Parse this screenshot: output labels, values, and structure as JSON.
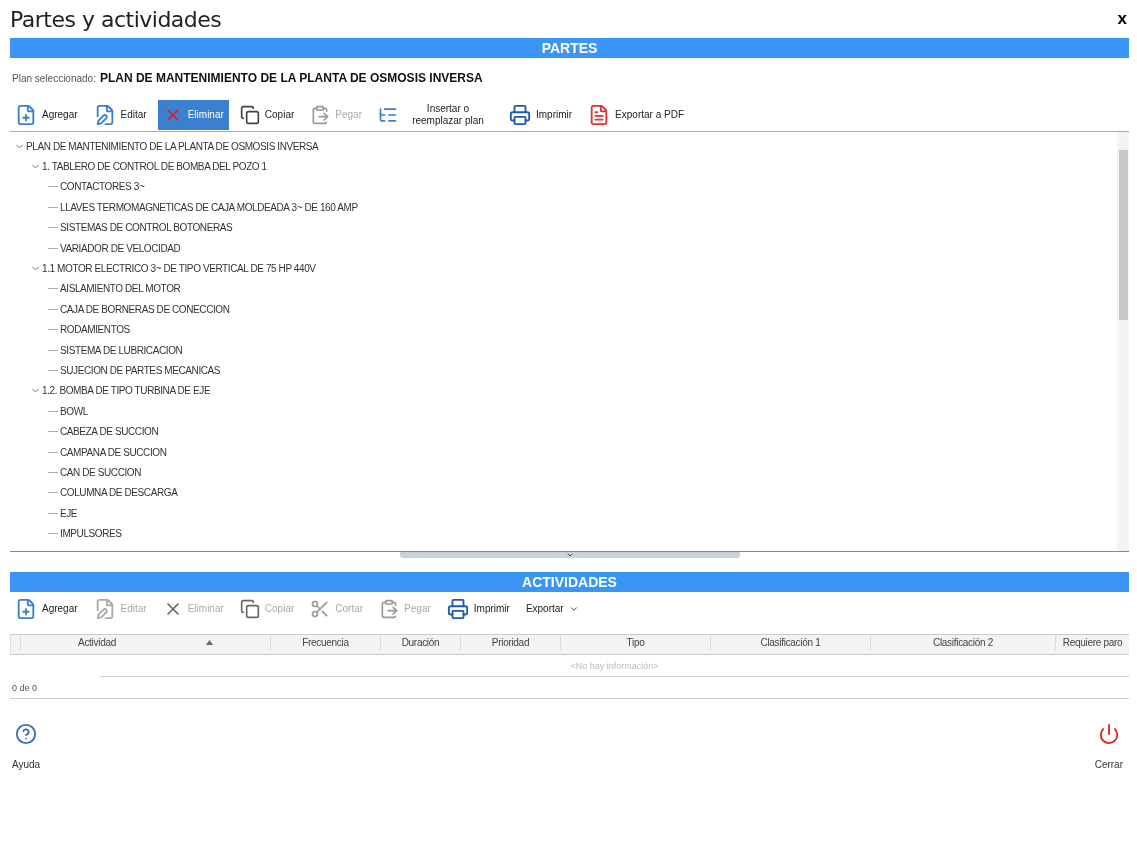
{
  "window": {
    "title": "Partes y actividades",
    "close": "x"
  },
  "parts": {
    "header": "PARTES",
    "plan_label": "Plan seleccionado:",
    "plan_name": "PLAN DE MANTENIMIENTO DE LA PLANTA DE OSMOSIS INVERSA",
    "toolbar": [
      {
        "kind": "button",
        "label": "Agregar",
        "disabled": false,
        "selected": false
      },
      {
        "kind": "button",
        "label": "Editar",
        "disabled": false,
        "selected": false
      },
      {
        "kind": "button",
        "label": "Eliminar",
        "disabled": false,
        "selected": true
      },
      {
        "kind": "button",
        "label": "Copiar",
        "disabled": false,
        "selected": false
      },
      {
        "kind": "button",
        "label": "Pegar",
        "disabled": true,
        "selected": false
      },
      {
        "kind": "button",
        "label": "Insertar o reemplazar plan",
        "disabled": false,
        "selected": false
      },
      {
        "kind": "button",
        "label": "Imprimir",
        "disabled": false,
        "selected": false
      },
      {
        "kind": "button",
        "label": "Exportar a PDF",
        "disabled": false,
        "selected": false
      }
    ],
    "tree": [
      {
        "label": "PLAN DE MANTENIMIENTO DE LA PLANTA DE OSMOSIS INVERSA",
        "expanded": true,
        "children": [
          {
            "label": "1. TABLERO DE CONTROL DE BOMBA DEL POZO 1",
            "expanded": true,
            "children": [
              {
                "label": "CONTACTORES 3~"
              },
              {
                "label": "LLAVES TERMOMAGNETICAS DE CAJA MOLDEADA 3~ DE 160 AMP"
              },
              {
                "label": "SISTEMAS DE CONTROL BOTONERAS"
              },
              {
                "label": "VARIADOR DE VELOCIDAD"
              }
            ]
          },
          {
            "label": "1.1 MOTOR ELECTRICO 3~ DE TIPO VERTICAL DE 75 HP 440V",
            "expanded": true,
            "children": [
              {
                "label": "AISLAMIENTO DEL MOTOR"
              },
              {
                "label": "CAJA DE BORNERAS DE CONECCION"
              },
              {
                "label": "RODAMIENTOS"
              },
              {
                "label": "SISTEMA DE LUBRICACION"
              },
              {
                "label": "SUJECION DE PARTES MECANICAS"
              }
            ]
          },
          {
            "label": "1.2. BOMBA DE TIPO TURBINA DE EJE",
            "expanded": true,
            "children": [
              {
                "label": "BOWL"
              },
              {
                "label": "CABEZA DE SUCCION"
              },
              {
                "label": "CAMPANA DE SUCCION"
              },
              {
                "label": "CAN DE SUCCION"
              },
              {
                "label": "COLUMNA DE DESCARGA"
              },
              {
                "label": "EJE"
              },
              {
                "label": "IMPULSORES"
              }
            ]
          }
        ]
      }
    ]
  },
  "activities": {
    "header": "ACTIVIDADES",
    "toolbar": [
      {
        "kind": "button",
        "label": "Agregar",
        "disabled": false,
        "selected": false
      },
      {
        "kind": "button",
        "label": "Editar",
        "disabled": true,
        "selected": false
      },
      {
        "kind": "button",
        "label": "Eliminar",
        "disabled": true,
        "selected": false
      },
      {
        "kind": "button",
        "label": "Copiar",
        "disabled": true,
        "selected": false
      },
      {
        "kind": "button",
        "label": "Cortar",
        "disabled": true,
        "selected": false
      },
      {
        "kind": "button",
        "label": "Pegar",
        "disabled": true,
        "selected": false
      },
      {
        "kind": "button",
        "label": "Imprimir",
        "disabled": false,
        "selected": false
      },
      {
        "kind": "dropdown",
        "label": "Exportar",
        "disabled": false,
        "selected": false
      }
    ],
    "columns": [
      {
        "label": "Actividad",
        "sorted": true
      },
      {
        "label": "Frecuencia",
        "sorted": false
      },
      {
        "label": "Duración",
        "sorted": false
      },
      {
        "label": "Prioridad",
        "sorted": false
      },
      {
        "label": "Tipo",
        "sorted": false
      },
      {
        "label": "Clasificación 1",
        "sorted": false
      },
      {
        "label": "Clasificación 2",
        "sorted": false
      },
      {
        "label": "Requiere paro",
        "sorted": false
      }
    ],
    "empty_message": "<No hay información>",
    "pager": "0 de 0"
  },
  "footer": {
    "help": "Ayuda",
    "close": "Cerrar"
  }
}
